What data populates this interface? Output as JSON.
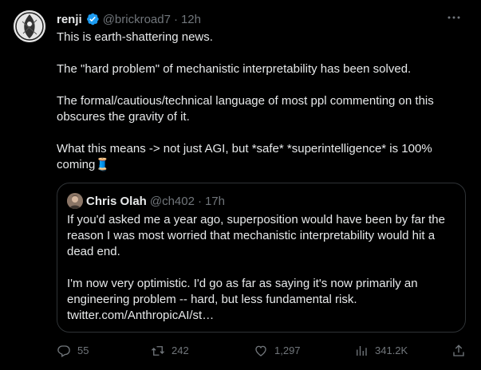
{
  "tweet": {
    "author": {
      "name": "renji",
      "handle": "@brickroad7",
      "time": "12h",
      "verified": true
    },
    "paragraphs": [
      "This is earth-shattering news.",
      "The \"hard problem\" of mechanistic interpretability has been solved.",
      "The formal/cautious/technical language of most ppl commenting on this obscures the gravity of it.",
      "What this means -> not just AGI, but *safe* *superintelligence* is 100% coming🧵"
    ],
    "quoted": {
      "name": "Chris Olah",
      "handle": "@ch402",
      "time": "17h",
      "paragraphs": [
        "If you'd asked me a year ago, superposition would have been by far the reason I was most worried that mechanistic interpretability would hit a dead end.",
        "I'm now very optimistic. I'd go as far as saying it's now primarily an engineering problem -- hard, but less fundamental risk.",
        "twitter.com/AnthropicAI/st…"
      ]
    },
    "actions": {
      "replies": "55",
      "retweets": "242",
      "likes": "1,297",
      "views": "341.2K"
    },
    "icons": [
      "verified-badge-icon",
      "more-icon",
      "reply-icon",
      "retweet-icon",
      "like-icon",
      "views-icon",
      "share-icon"
    ],
    "colors": {
      "background": "#000000",
      "text": "#e7e9ea",
      "muted": "#71767b",
      "verified": "#1d9bf0",
      "border": "#2f3336"
    }
  }
}
